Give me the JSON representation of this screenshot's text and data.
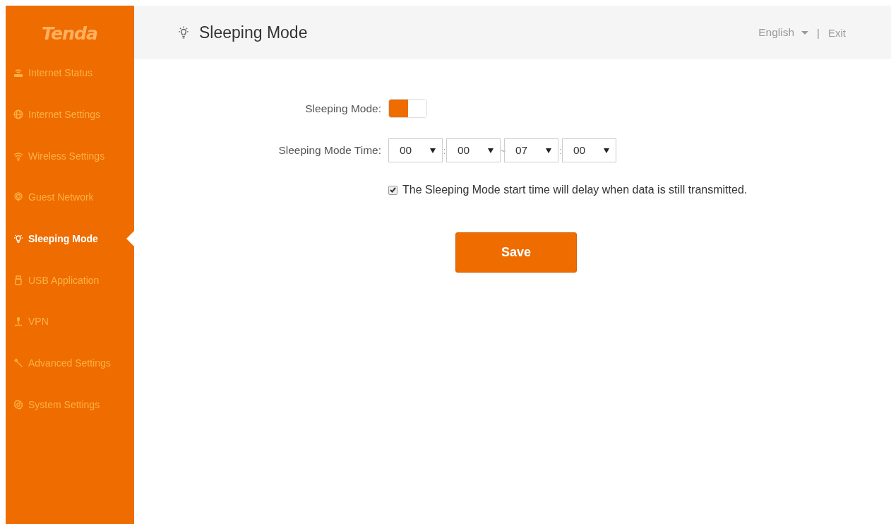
{
  "sidebar": {
    "logo": "Tenda",
    "items": [
      {
        "label": "Internet Status",
        "selected": false
      },
      {
        "label": "Internet Settings",
        "selected": false
      },
      {
        "label": "Wireless Settings",
        "selected": false
      },
      {
        "label": "Guest Network",
        "selected": false
      },
      {
        "label": "Sleeping Mode",
        "selected": true
      },
      {
        "label": "USB Application",
        "selected": false
      },
      {
        "label": "VPN",
        "selected": false
      },
      {
        "label": "Advanced Settings",
        "selected": false
      },
      {
        "label": "System Settings",
        "selected": false
      }
    ]
  },
  "header": {
    "title": "Sleeping Mode",
    "language": "English",
    "separator": "|",
    "exit": "Exit"
  },
  "form": {
    "toggle_label": "Sleeping Mode:",
    "toggle_on": true,
    "time_label": "Sleeping Mode Time:",
    "time_fields": [
      {
        "value": "00"
      },
      {
        "sep": ":",
        "value": "00"
      },
      {
        "sep": "~",
        "value": "07"
      },
      {
        "sep": ":",
        "value": "00"
      }
    ],
    "delay_checked": true,
    "delay_text": "The Sleeping Mode start time will delay when data is still transmitted.",
    "save": "Save"
  }
}
